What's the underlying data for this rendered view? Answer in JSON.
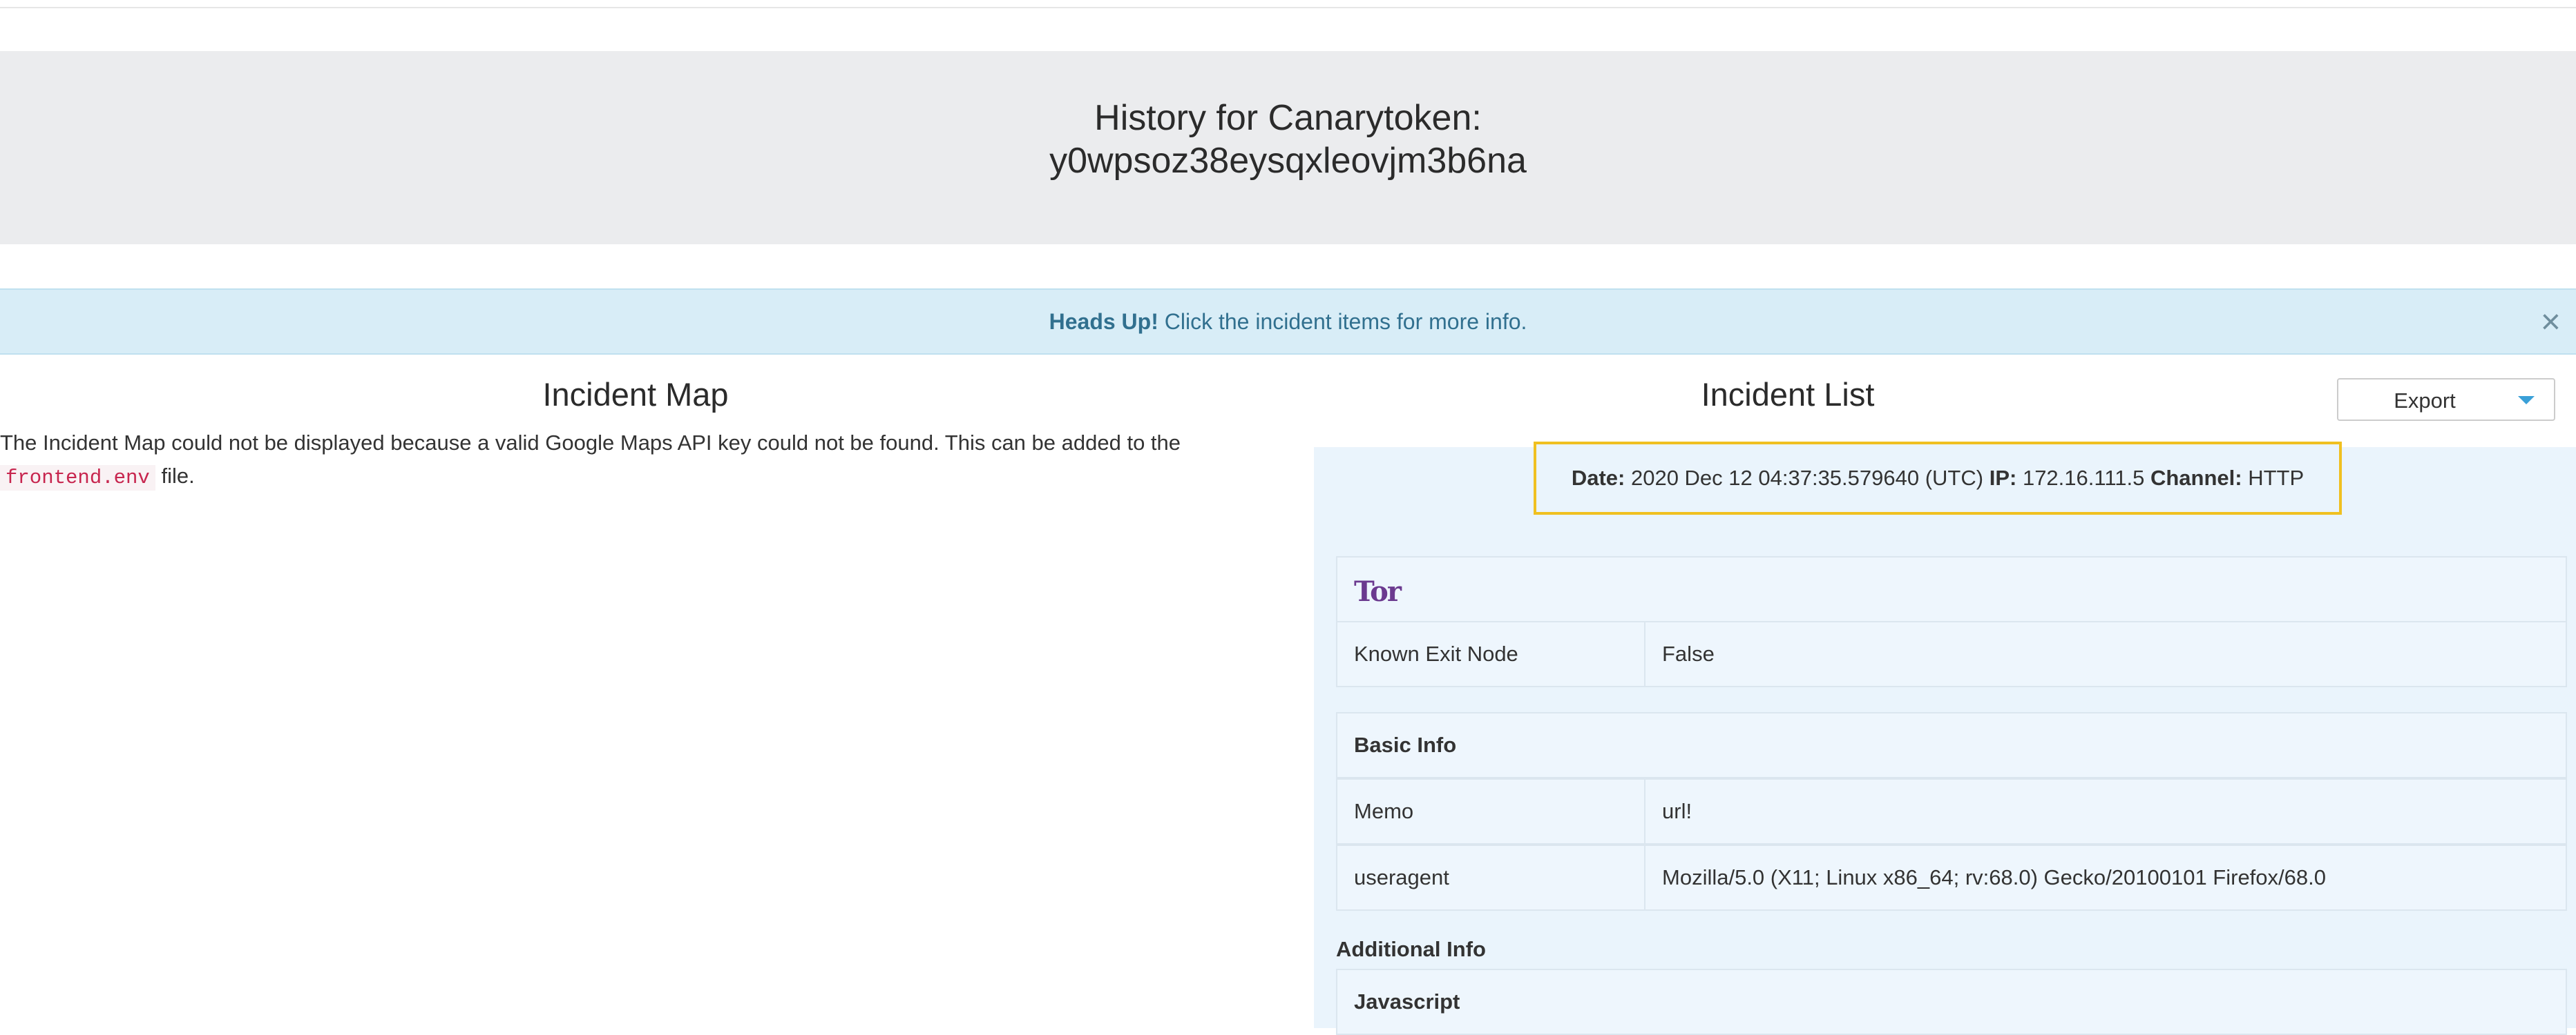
{
  "header": {
    "title_line1": "History for Canarytoken:",
    "title_line2": "y0wpsoz38eysqxleovjm3b6na"
  },
  "alert": {
    "strong": "Heads Up!",
    "text": " Click the incident items for more info.",
    "close": "×"
  },
  "map": {
    "title": "Incident Map",
    "message": "The Incident Map could not be displayed because a valid Google Maps API key could not be found. This can be added to the",
    "code": "frontend.env",
    "message_end": " file."
  },
  "incidents": {
    "title": "Incident List",
    "export_label": "Export",
    "summary": {
      "date_label": "Date:",
      "date": "2020 Dec 12 04:37:35.579640 (UTC)",
      "ip_label": "IP:",
      "ip": "172.16.111.5",
      "channel_label": "Channel:",
      "channel": "HTTP"
    },
    "tor_logo": "Tor",
    "known_exit_node": {
      "key": "Known Exit Node",
      "value": "False"
    },
    "basic_info_header": "Basic Info",
    "memo": {
      "key": "Memo",
      "value": "url!"
    },
    "useragent": {
      "key": "useragent",
      "value": "Mozilla/5.0 (X11; Linux x86_64; rv:68.0) Gecko/20100101 Firefox/68.0"
    },
    "additional_info": "Additional Info",
    "javascript_header": "Javascript"
  },
  "colors": {
    "alert_bg": "#d8edf7",
    "alert_text": "#31708f",
    "highlight_border": "#f0c020",
    "panel_bg": "#eaf4fc"
  }
}
